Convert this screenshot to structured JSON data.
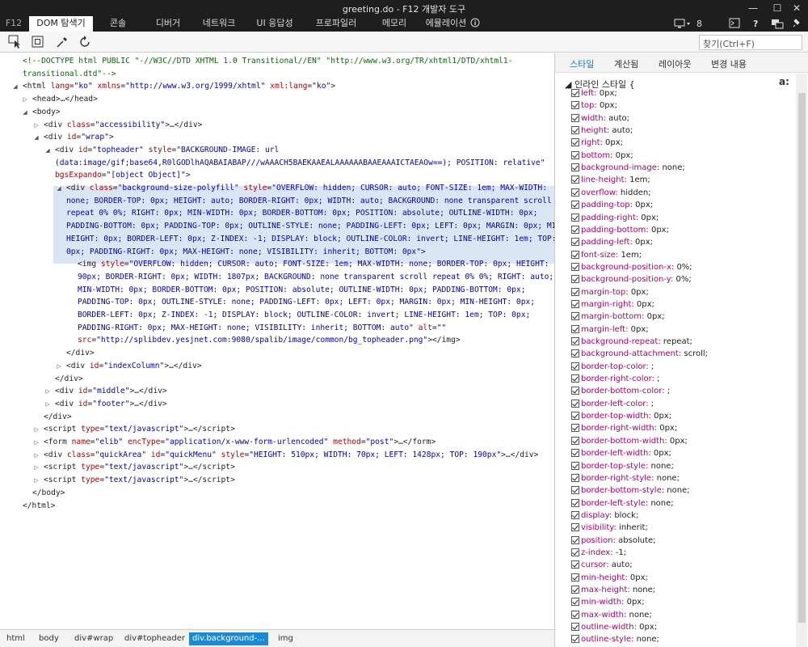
{
  "window": {
    "title": "greeting.do - F12 개발자 도구"
  },
  "tabs": {
    "f12": "F12",
    "items": [
      "DOM 탐색기",
      "콘솔",
      "디버거",
      "네트워크",
      "UI 응답성",
      "프로파일러",
      "메모리",
      "에뮬레이션"
    ],
    "active": "DOM 탐색기",
    "count": "8"
  },
  "toolbar": {
    "find_placeholder": "찾기(Ctrl+F)"
  },
  "dom": {
    "lines": [
      {
        "indent": 28,
        "tw": "",
        "html": "<span class='cm'>&lt;!--DOCTYPE html PUBLIC \"-//W3C//DTD XHTML 1.0 Transitional//EN\" \"http://www.w3.org/TR/xhtml1/DTD/xhtml1-</span>"
      },
      {
        "indent": 28,
        "tw": "",
        "html": "<span class='cm'>transitional.dtd\"--&gt;</span>"
      },
      {
        "indent": 28,
        "tw": "◢",
        "html": "&lt;html <span class='an'>lang</span>=<span class='av'>\"ko\"</span> <span class='an'>xmlns</span>=<span class='av'>\"http://www.w3.org/1999/xhtml\"</span> <span class='an'>xml:lang</span>=<span class='av'>\"ko\"</span>&gt;"
      },
      {
        "indent": 40,
        "tw": "▷",
        "html": "&lt;head&gt;…&lt;/head&gt;"
      },
      {
        "indent": 40,
        "tw": "◢",
        "html": "&lt;body&gt;"
      },
      {
        "indent": 54,
        "tw": "▷",
        "html": "&lt;div <span class='an'>class</span>=<span class='av'>\"accessibility\"</span>&gt;…&lt;/div&gt;"
      },
      {
        "indent": 54,
        "tw": "◢",
        "html": "&lt;div <span class='an'>id</span>=<span class='av'>\"wrap\"</span>&gt;"
      },
      {
        "indent": 68,
        "tw": "◢",
        "html": "&lt;div <span class='an'>id</span>=<span class='av'>\"topheader\"</span> <span class='an'>style</span>=<span class='av'>\"BACKGROUND-IMAGE: url</span>"
      },
      {
        "indent": 68,
        "tw": "",
        "html": "<span class='av'>(data:image/gif;base64,R0lGODlhAQABAIABAP///wAAACH5BAEKAAEALAAAAAABAAEAAAICTAEAOw==); POSITION: relative\"</span>"
      },
      {
        "indent": 68,
        "tw": "",
        "html": "<span class='an'>bgsExpando</span>=<span class='av'>\"[object Object]\"</span>&gt;"
      },
      {
        "indent": 82,
        "tw": "◢",
        "html": "&lt;div <span class='an'>class</span>=<span class='av'>\"background-size-polyfill\"</span> <span class='an'>style</span>=<span class='av'>\"OVERFLOW: hidden; CURSOR: auto; FONT-SIZE: 1em; MAX-WIDTH:</span>"
      },
      {
        "indent": 82,
        "tw": "",
        "html": "<span class='av'>none; BORDER-TOP: 0px; HEIGHT: auto; BORDER-RIGHT: 0px; WIDTH: auto; BACKGROUND: none transparent scroll</span>"
      },
      {
        "indent": 82,
        "tw": "",
        "html": "<span class='av'>repeat 0% 0%; RIGHT: 0px; MIN-WIDTH: 0px; BORDER-BOTTOM: 0px; POSITION: absolute; OUTLINE-WIDTH: 0px;</span>"
      },
      {
        "indent": 82,
        "tw": "",
        "html": "<span class='av'>PADDING-BOTTOM: 0px; PADDING-TOP: 0px; OUTLINE-STYLE: none; PADDING-LEFT: 0px; LEFT: 0px; MARGIN: 0px; MIN-</span>"
      },
      {
        "indent": 82,
        "tw": "",
        "html": "<span class='av'>HEIGHT: 0px; BORDER-LEFT: 0px; Z-INDEX: -1; DISPLAY: block; OUTLINE-COLOR: invert; LINE-HEIGHT: 1em; TOP:</span>"
      },
      {
        "indent": 82,
        "tw": "",
        "html": "<span class='av'>0px; PADDING-RIGHT: 0px; MAX-HEIGHT: none; VISIBILITY: inherit; BOTTOM: 0px\"</span>&gt;"
      },
      {
        "indent": 96,
        "tw": "",
        "html": "&lt;img <span class='an'>style</span>=<span class='av'>\"OVERFLOW: hidden; CURSOR: auto; FONT-SIZE: 1em; MAX-WIDTH: none; BORDER-TOP: 0px; HEIGHT:</span>"
      },
      {
        "indent": 96,
        "tw": "",
        "html": "<span class='av'>90px; BORDER-RIGHT: 0px; WIDTH: 1807px; BACKGROUND: none transparent scroll repeat 0% 0%; RIGHT: auto;</span>"
      },
      {
        "indent": 96,
        "tw": "",
        "html": "<span class='av'>MIN-WIDTH: 0px; BORDER-BOTTOM: 0px; POSITION: absolute; OUTLINE-WIDTH: 0px; PADDING-BOTTOM: 0px;</span>"
      },
      {
        "indent": 96,
        "tw": "",
        "html": "<span class='av'>PADDING-TOP: 0px; OUTLINE-STYLE: none; PADDING-LEFT: 0px; LEFT: 0px; MARGIN: 0px; MIN-HEIGHT: 0px;</span>"
      },
      {
        "indent": 96,
        "tw": "",
        "html": "<span class='av'>BORDER-LEFT: 0px; Z-INDEX: -1; DISPLAY: block; OUTLINE-COLOR: invert; LINE-HEIGHT: 1em; TOP: 0px;</span>"
      },
      {
        "indent": 96,
        "tw": "",
        "html": "<span class='av'>PADDING-RIGHT: 0px; MAX-HEIGHT: none; VISIBILITY: inherit; BOTTOM: auto\"</span> <span class='an'>alt</span>=<span class='av'>\"\"</span>"
      },
      {
        "indent": 96,
        "tw": "",
        "html": "<span class='an'>src</span>=<span class='av'>\"http://splibdev.yesjnet.com:9080/spalib/image/common/bg_topheader.png\"</span>&gt;&lt;/img&gt;"
      },
      {
        "indent": 82,
        "tw": "",
        "html": "&lt;/div&gt;"
      },
      {
        "indent": 82,
        "tw": "▷",
        "html": "&lt;div <span class='an'>id</span>=<span class='av'>\"indexColumn\"</span>&gt;…&lt;/div&gt;"
      },
      {
        "indent": 68,
        "tw": "",
        "html": "&lt;/div&gt;"
      },
      {
        "indent": 68,
        "tw": "▷",
        "html": "&lt;div <span class='an'>id</span>=<span class='av'>\"middle\"</span>&gt;…&lt;/div&gt;"
      },
      {
        "indent": 68,
        "tw": "▷",
        "html": "&lt;div <span class='an'>id</span>=<span class='av'>\"footer\"</span>&gt;…&lt;/div&gt;"
      },
      {
        "indent": 54,
        "tw": "",
        "html": "&lt;/div&gt;"
      },
      {
        "indent": 54,
        "tw": "▷",
        "html": "&lt;script <span class='an'>type</span>=<span class='av'>\"text/javascript\"</span>&gt;…&lt;/script&gt;"
      },
      {
        "indent": 54,
        "tw": "▷",
        "html": "&lt;form <span class='an'>name</span>=<span class='av'>\"elib\"</span> <span class='an'>encType</span>=<span class='av'>\"application/x-www-form-urlencoded\"</span> <span class='an'>method</span>=<span class='av'>\"post\"</span>&gt;…&lt;/form&gt;"
      },
      {
        "indent": 54,
        "tw": "▷",
        "html": "&lt;div <span class='an'>class</span>=<span class='av'>\"quickArea\"</span> <span class='an'>id</span>=<span class='av'>\"quickMenu\"</span> <span class='an'>style</span>=<span class='av'>\"HEIGHT: 510px; WIDTH: 70px; LEFT: 1428px; TOP: 190px\"</span>&gt;…&lt;/div&gt;"
      },
      {
        "indent": 54,
        "tw": "▷",
        "html": "&lt;script <span class='an'>type</span>=<span class='av'>\"text/javascript\"</span>&gt;…&lt;/script&gt;"
      },
      {
        "indent": 54,
        "tw": "▷",
        "html": "&lt;script <span class='an'>type</span>=<span class='av'>\"text/javascript\"</span>&gt;…&lt;/script&gt;"
      },
      {
        "indent": 40,
        "tw": "",
        "html": "&lt;/body&gt;"
      },
      {
        "indent": 28,
        "tw": "",
        "html": "&lt;/html&gt;"
      }
    ]
  },
  "styles": {
    "tabs": [
      "스타일",
      "계산됨",
      "레이아웃",
      "변경 내용"
    ],
    "active_tab": "스타일",
    "inline_header": "◢ 인라인 스타일  {",
    "a_icon": "a:",
    "props": [
      [
        "left",
        "0px;"
      ],
      [
        "top",
        "0px;"
      ],
      [
        "width",
        "auto;"
      ],
      [
        "height",
        "auto;"
      ],
      [
        "right",
        "0px;"
      ],
      [
        "bottom",
        "0px;"
      ],
      [
        "background-image",
        "none;"
      ],
      [
        "line-height",
        "1em;"
      ],
      [
        "overflow",
        "hidden;"
      ],
      [
        "padding-top",
        "0px;"
      ],
      [
        "padding-right",
        "0px;"
      ],
      [
        "padding-bottom",
        "0px;"
      ],
      [
        "padding-left",
        "0px;"
      ],
      [
        "font-size",
        "1em;"
      ],
      [
        "background-position-x",
        "0%;"
      ],
      [
        "background-position-y",
        "0%;"
      ],
      [
        "margin-top",
        "0px;"
      ],
      [
        "margin-right",
        "0px;"
      ],
      [
        "margin-bottom",
        "0px;"
      ],
      [
        "margin-left",
        "0px;"
      ],
      [
        "background-repeat",
        "repeat;"
      ],
      [
        "background-attachment",
        "scroll;"
      ],
      [
        "border-top-color",
        "   ;"
      ],
      [
        "border-right-color",
        "   ;"
      ],
      [
        "border-bottom-color",
        "   ;"
      ],
      [
        "border-left-color",
        "   ;"
      ],
      [
        "border-top-width",
        "0px;"
      ],
      [
        "border-right-width",
        "0px;"
      ],
      [
        "border-bottom-width",
        "0px;"
      ],
      [
        "border-left-width",
        "0px;"
      ],
      [
        "border-top-style",
        "none;"
      ],
      [
        "border-right-style",
        "none;"
      ],
      [
        "border-bottom-style",
        "none;"
      ],
      [
        "border-left-style",
        "none;"
      ],
      [
        "display",
        "block;"
      ],
      [
        "visibility",
        "inherit;"
      ],
      [
        "position",
        "absolute;"
      ],
      [
        "z-index",
        "-1;"
      ],
      [
        "cursor",
        "auto;"
      ],
      [
        "min-height",
        "0px;"
      ],
      [
        "max-height",
        "none;"
      ],
      [
        "min-width",
        "0px;"
      ],
      [
        "max-width",
        "none;"
      ],
      [
        "outline-width",
        "0px;"
      ],
      [
        "outline-style",
        "none;"
      ]
    ]
  },
  "breadcrumb": {
    "items": [
      "html",
      "body",
      "div#wrap",
      "div#topheader",
      "div.background-...",
      "img"
    ],
    "active": "div.background-..."
  }
}
